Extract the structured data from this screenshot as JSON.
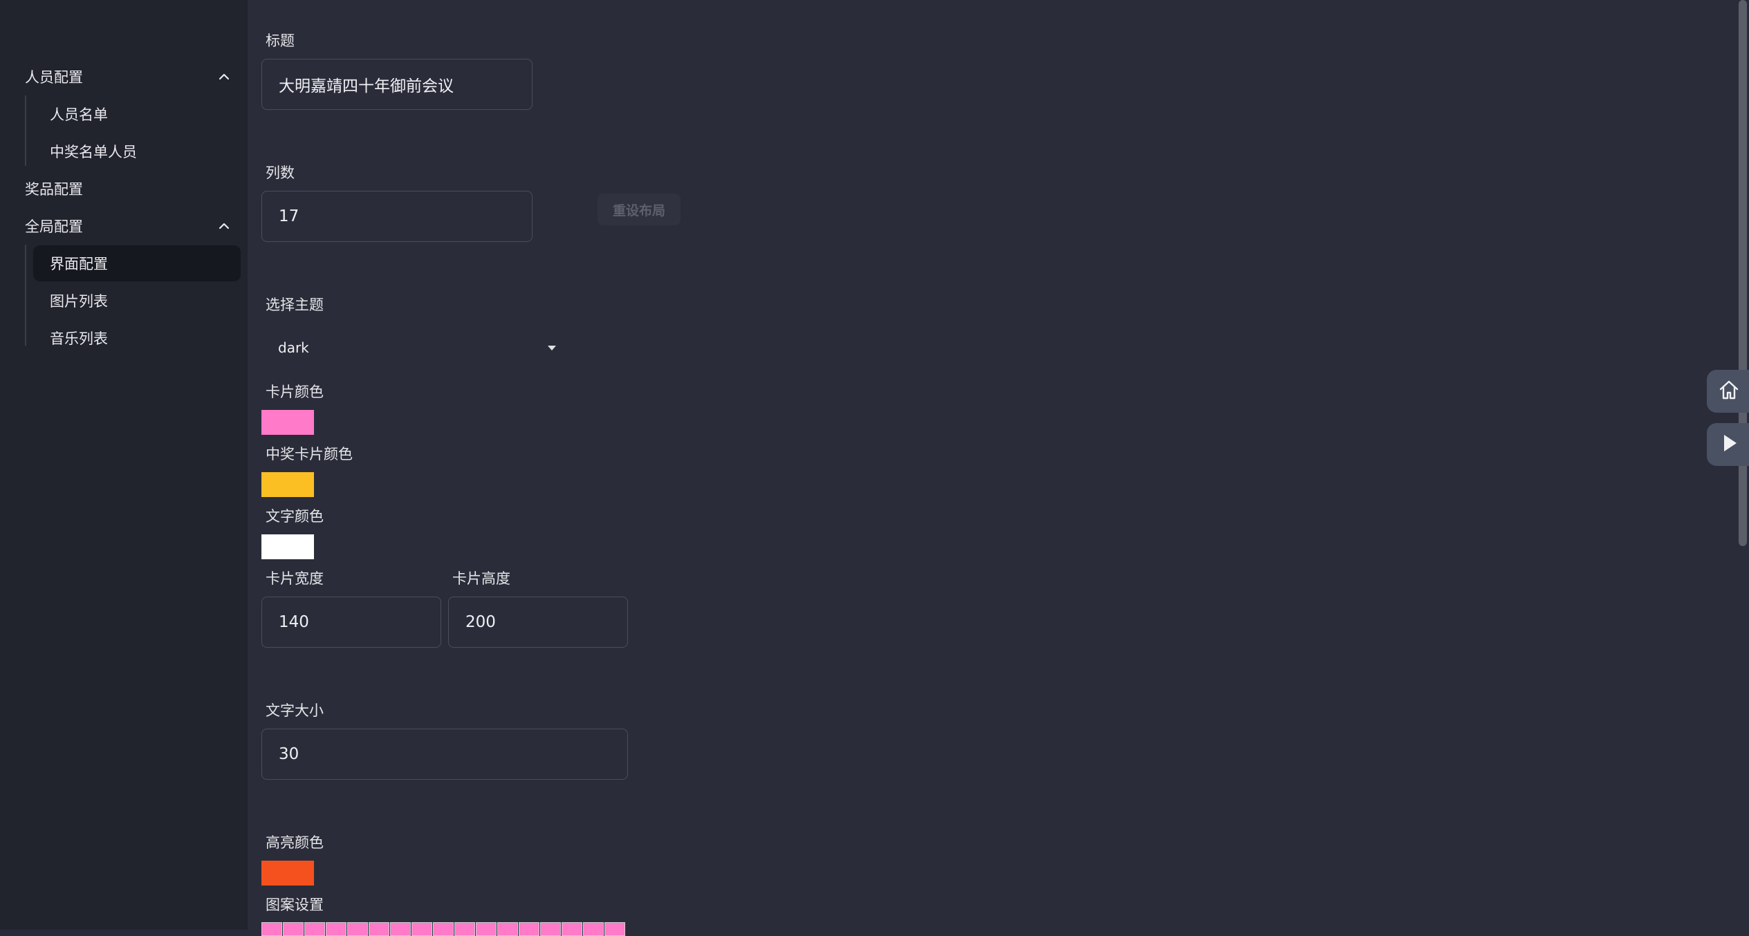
{
  "sidebar": {
    "groups": [
      {
        "label": "人员配置",
        "children": [
          "人员名单",
          "中奖名单人员"
        ]
      },
      {
        "label": "奖品配置"
      },
      {
        "label": "全局配置",
        "children": [
          "界面配置",
          "图片列表",
          "音乐列表"
        ]
      }
    ],
    "active_item": "界面配置"
  },
  "form": {
    "title_label": "标题",
    "title_value": "大明嘉靖四十年御前会议",
    "columns_label": "列数",
    "columns_value": "17",
    "reset_layout_button": "重设布局",
    "theme_label": "选择主题",
    "theme_value": "dark",
    "card_color_label": "卡片颜色",
    "card_color": "#ff7ac8",
    "winner_card_color_label": "中奖卡片颜色",
    "winner_card_color": "#fbbf24",
    "text_color_label": "文字颜色",
    "text_color": "#ffffff",
    "card_width_label": "卡片宽度",
    "card_width_value": "140",
    "card_height_label": "卡片高度",
    "card_height_value": "200",
    "font_size_label": "文字大小",
    "font_size_value": "30",
    "highlight_color_label": "高亮颜色",
    "highlight_color": "#f4511e",
    "pattern_label": "图案设置",
    "pattern_cell_color": "#ff7ac8"
  },
  "float_buttons": [
    {
      "icon": "home-icon"
    },
    {
      "icon": "play-icon"
    }
  ],
  "colors": {
    "page_bg": "#2a2d39",
    "sidebar_bg": "#21232d",
    "active_item_bg": "#16181f"
  }
}
